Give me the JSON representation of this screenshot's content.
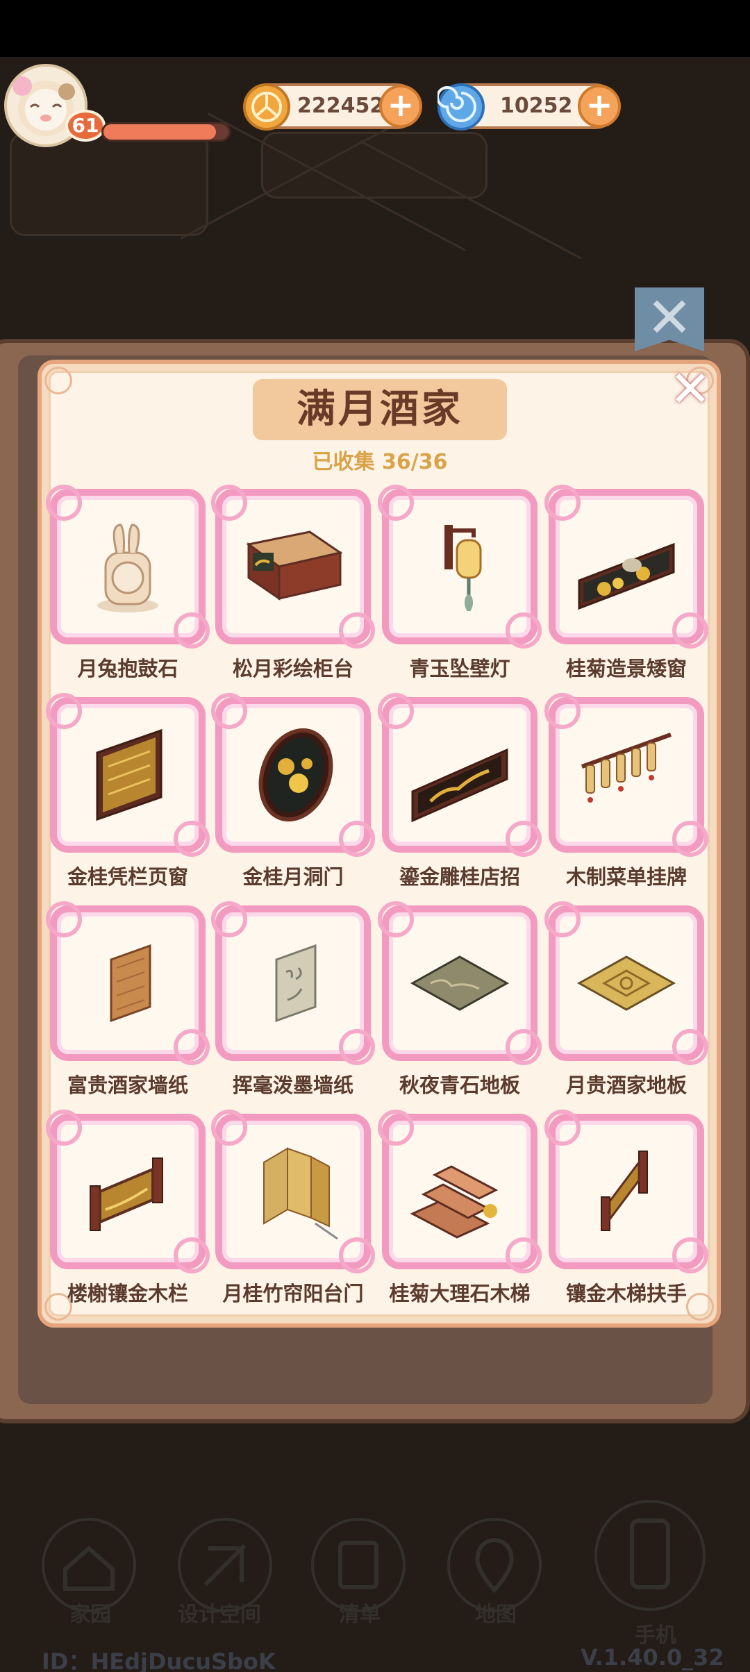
{
  "hud": {
    "level": "61",
    "xp_fraction": 0.9,
    "coins": "222452",
    "gems": "10252",
    "plus": "+"
  },
  "panel": {
    "title": "满月酒家",
    "collected": "已收集 36/36",
    "close": "✕"
  },
  "items": [
    {
      "label": "月兔抱鼓石"
    },
    {
      "label": "松月彩绘柜台"
    },
    {
      "label": "青玉坠壁灯"
    },
    {
      "label": "桂菊造景矮窗"
    },
    {
      "label": "金桂凭栏页窗"
    },
    {
      "label": "金桂月洞门"
    },
    {
      "label": "鎏金雕桂店招"
    },
    {
      "label": "木制菜单挂牌"
    },
    {
      "label": "富贵酒家墙纸"
    },
    {
      "label": "挥毫泼墨墙纸"
    },
    {
      "label": "秋夜青石地板"
    },
    {
      "label": "月贵酒家地板"
    },
    {
      "label": "楼榭镶金木栏"
    },
    {
      "label": "月桂竹帘阳台门"
    },
    {
      "label": "桂菊大理石木梯"
    },
    {
      "label": "镶金木梯扶手"
    }
  ],
  "nav": [
    {
      "label": "家园",
      "icon": "house-icon"
    },
    {
      "label": "设计空间",
      "icon": "pencil-ruler-icon"
    },
    {
      "label": "清单",
      "icon": "list-icon"
    },
    {
      "label": "地图",
      "icon": "map-pin-icon"
    },
    {
      "label": "手机",
      "icon": "phone-icon"
    }
  ],
  "footer": {
    "id": "ID：HEdjDucuSboK",
    "version": "V.1.40.0_32"
  },
  "colors": {
    "frame_pink": "#f39ac0",
    "panel_bg": "#fdf3e6",
    "title_bg": "#f1c99c",
    "collected_gold": "#d9a34a"
  }
}
